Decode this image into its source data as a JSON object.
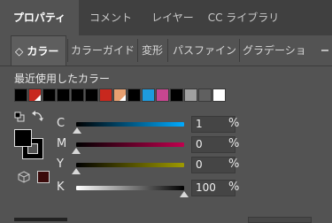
{
  "tabs": [
    {
      "label": "プロパティ",
      "active": true
    },
    {
      "label": "コメント",
      "active": false
    },
    {
      "label": "レイヤー",
      "active": false
    },
    {
      "label": "CC ライブラリ",
      "active": false
    }
  ],
  "subtabs": [
    {
      "label": "◇ カラー",
      "active": true
    },
    {
      "label": "カラーガイド",
      "active": false
    },
    {
      "label": "変形",
      "active": false
    },
    {
      "label": "パスファイン",
      "active": false
    },
    {
      "label": "グラデーショ",
      "active": false
    }
  ],
  "recent": {
    "label": "最近使用したカラー",
    "swatches": [
      "#000000",
      "#c8281e",
      "#000000",
      "#000000",
      "#000000",
      "#000000",
      "#c8281e",
      "#e8a070",
      "#000000",
      "#1e9bdc",
      "#c84690",
      "#000000",
      "#a0a0a0",
      "#606060",
      "#ffffff"
    ]
  },
  "sliders": [
    {
      "label": "C",
      "value": "1",
      "unit": "%",
      "level": 0.01,
      "gradient": "linear-gradient(to right,#000000,#00aaff)"
    },
    {
      "label": "M",
      "value": "0",
      "unit": "%",
      "level": 0.0,
      "gradient": "linear-gradient(to right,#000000,#c0004e)"
    },
    {
      "label": "Y",
      "value": "0",
      "unit": "%",
      "level": 0.0,
      "gradient": "linear-gradient(to right,#000000,#9e9a00)"
    },
    {
      "label": "K",
      "value": "100",
      "unit": "%",
      "level": 1.0,
      "gradient": "linear-gradient(to right,#ffffff,#000000)"
    }
  ],
  "colors": {
    "panel_bg": "#535353",
    "tabbar_bg": "#404040",
    "current_color": "#3a0a0a"
  },
  "icons": {
    "swap": "swap-arrow-icon",
    "default": "default-fill-stroke-icon",
    "cube": "out-of-gamut-cube-icon",
    "menu": "panel-menu-icon"
  }
}
